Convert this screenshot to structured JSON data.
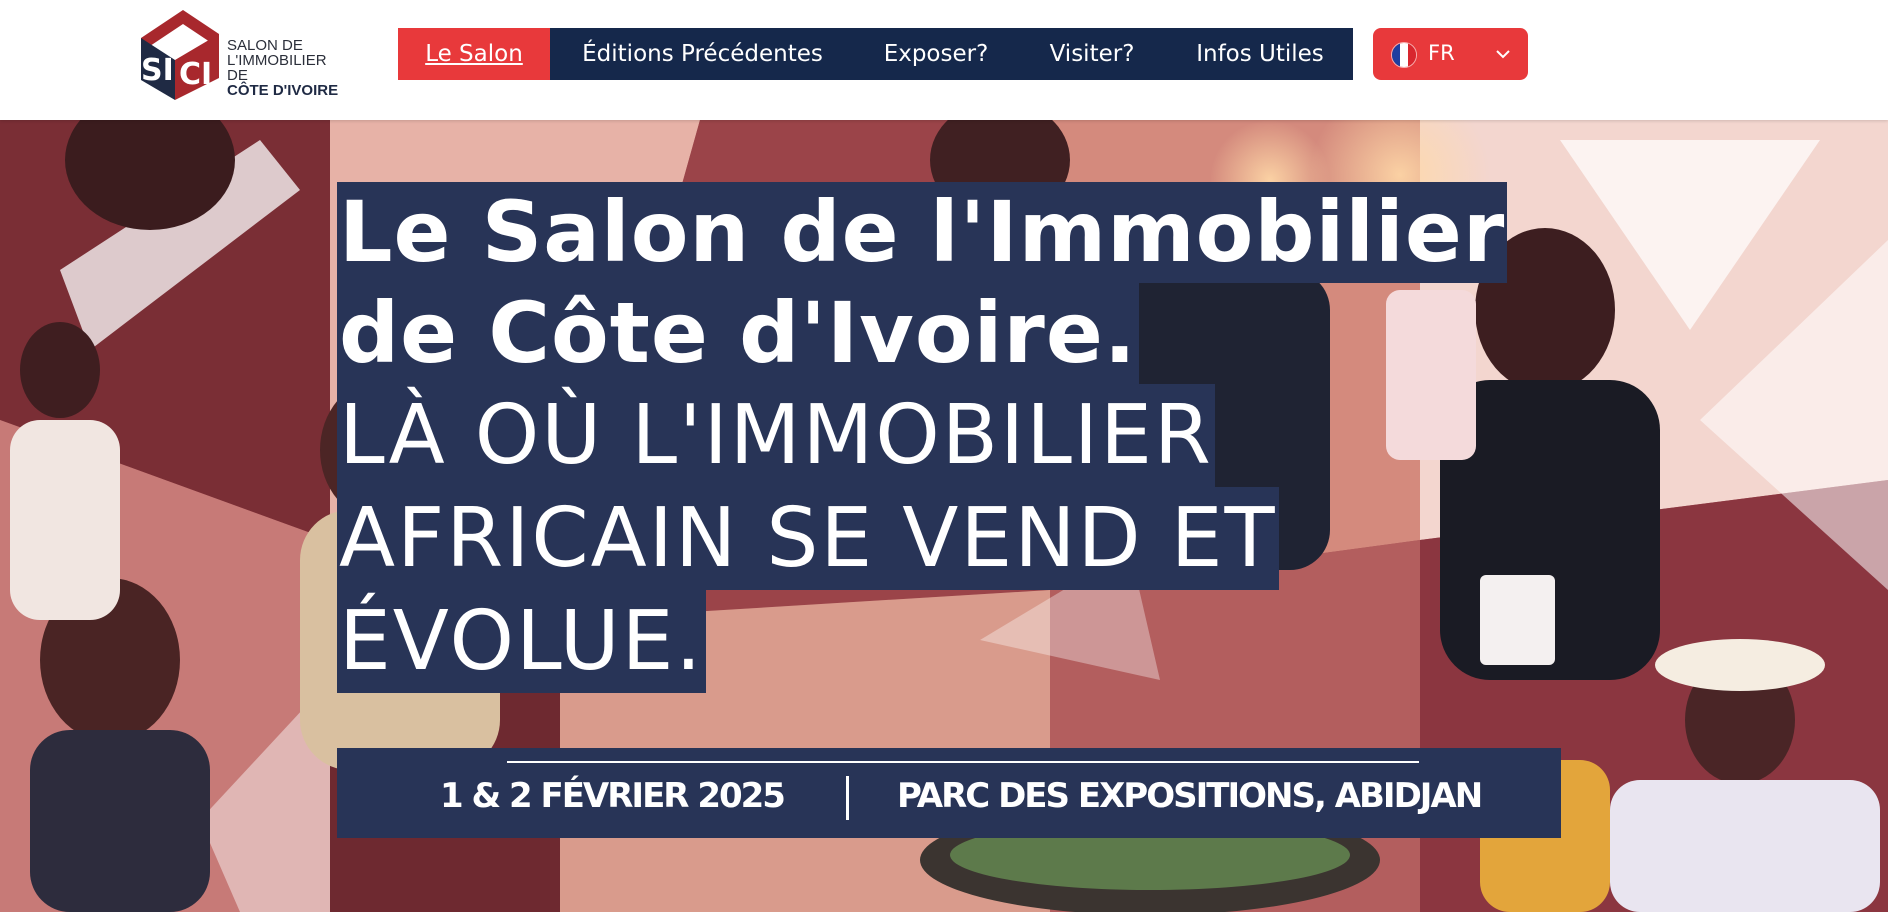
{
  "brand": {
    "logo_letters": "SICI",
    "line1": "SALON DE",
    "line2": "L'IMMOBILIER DE",
    "line3": "CÔTE D'IVOIRE"
  },
  "nav": {
    "items": [
      {
        "label": "Le Salon",
        "active": true
      },
      {
        "label": "Éditions Précédentes",
        "active": false
      },
      {
        "label": "Exposer?",
        "active": false
      },
      {
        "label": "Visiter?",
        "active": false
      },
      {
        "label": "Infos Utiles",
        "active": false
      }
    ]
  },
  "language": {
    "selected": "FR",
    "flag_icon": "france-flag-icon",
    "chevron_icon": "chevron-down-icon"
  },
  "hero": {
    "title_line1": "Le Salon de l'Immobilier",
    "title_line2": "de Côte d'Ivoire.",
    "tagline_line1": "LÀ OÙ L'IMMOBILIER",
    "tagline_line2": "AFRICAIN SE VEND ET",
    "tagline_line3": "ÉVOLUE.",
    "event_date": "1 & 2 FÉVRIER 2025",
    "event_place": "PARC DES EXPOSITIONS, ABIDJAN"
  },
  "colors": {
    "navy": "#15284b",
    "highlight_navy": "#283457",
    "accent_red": "#e8393b",
    "white": "#ffffff"
  }
}
